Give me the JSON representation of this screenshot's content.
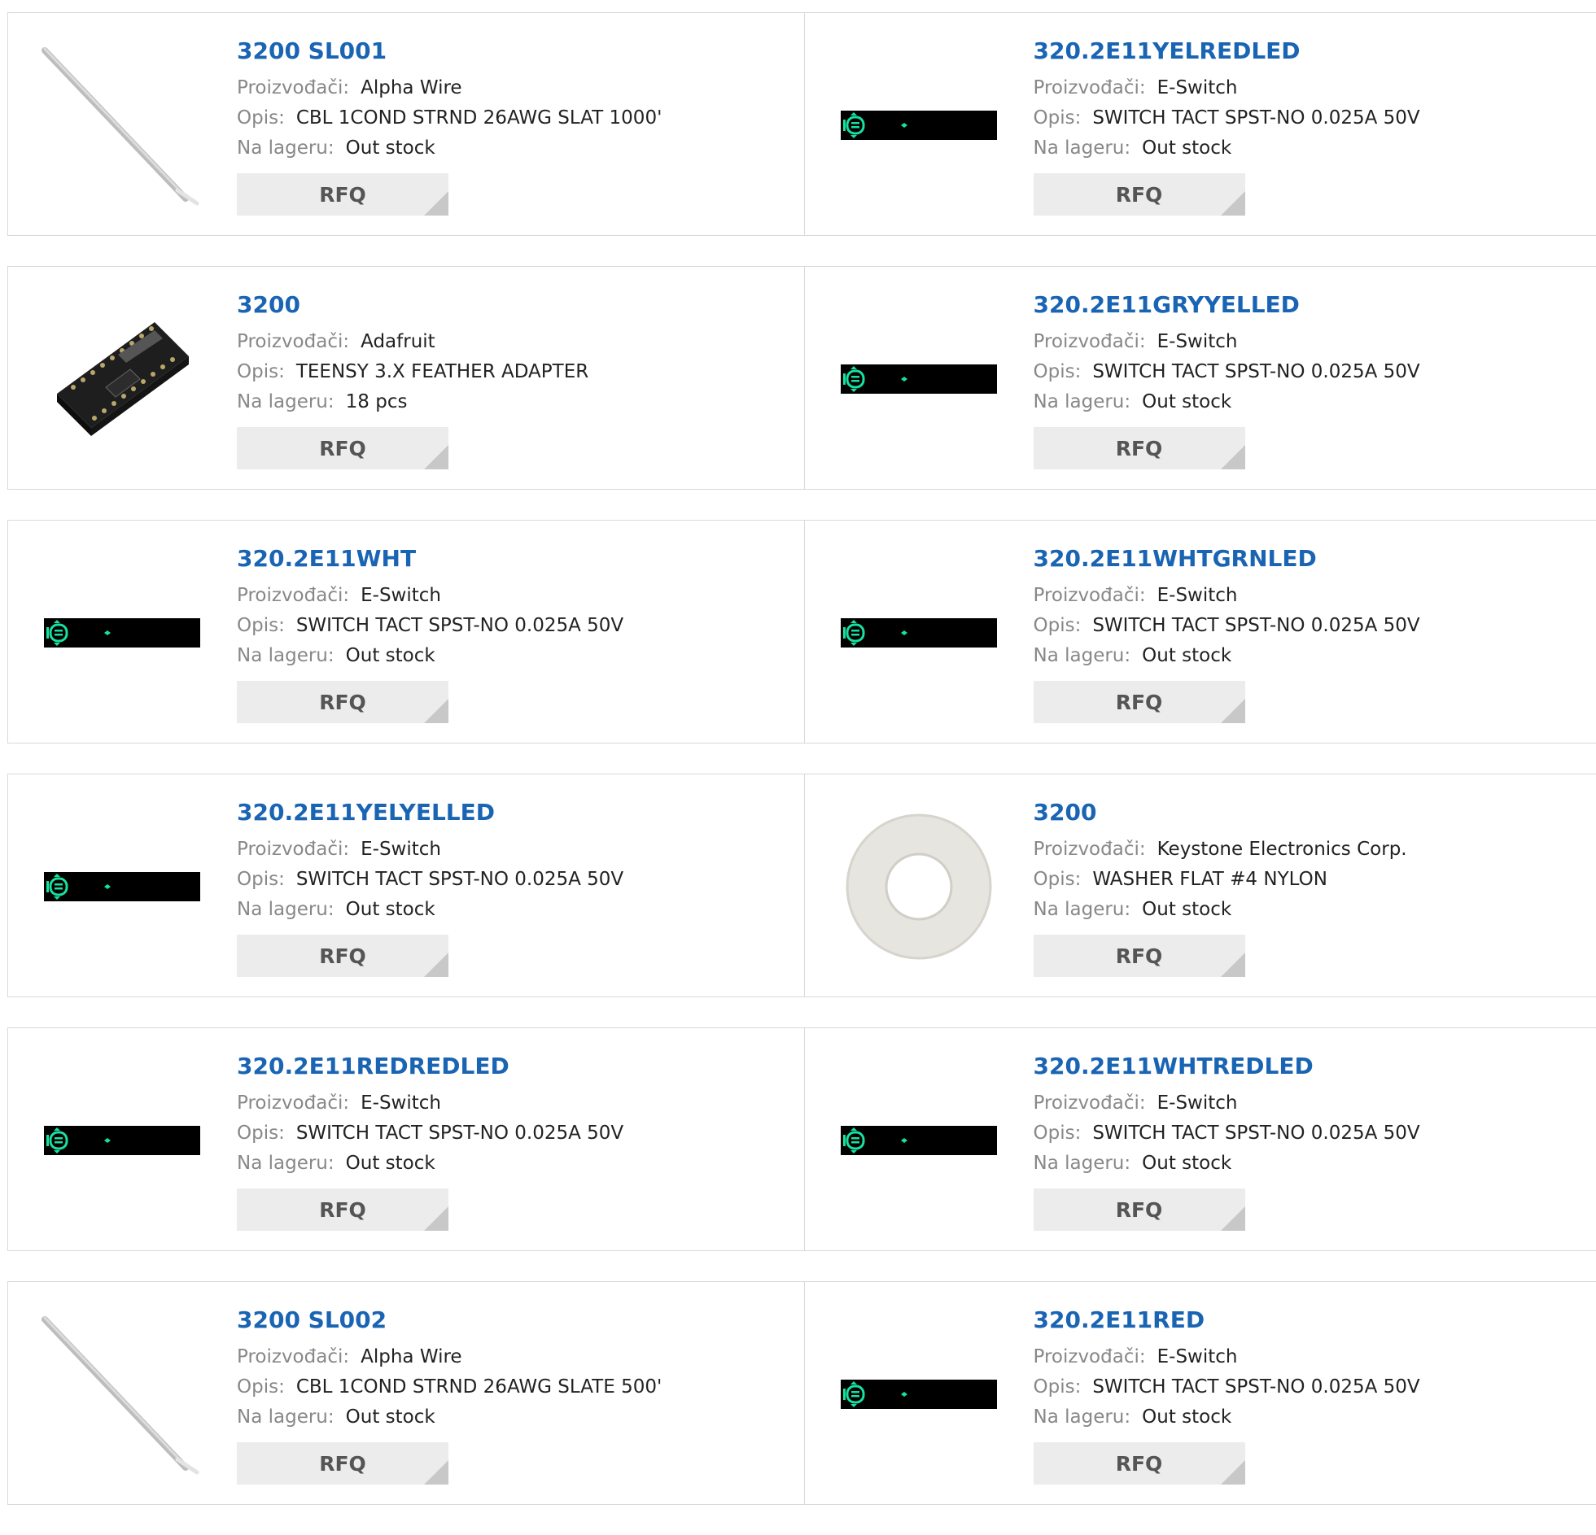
{
  "labels": {
    "manufacturer": "Proizvođači:",
    "description": "Opis:",
    "stock": "Na lageru:",
    "rfq": "RFQ"
  },
  "colors": {
    "part_link": "#1a64b4",
    "chip_body": "#000000",
    "chip_led": "#17e0a0"
  },
  "rows": [
    [
      {
        "part": "3200 SL001",
        "manufacturer": "Alpha Wire",
        "description": "CBL 1COND STRND 26AWG SLAT 1000'",
        "stock": "Out stock",
        "image": "wire-icon"
      },
      {
        "part": "320.2E11YELREDLED",
        "manufacturer": "E-Switch",
        "description": "SWITCH TACT SPST-NO 0.025A 50V",
        "stock": "Out stock",
        "image": "switch-icon"
      }
    ],
    [
      {
        "part": "3200",
        "manufacturer": "Adafruit",
        "description": "TEENSY 3.X FEATHER ADAPTER",
        "stock": "18 pcs",
        "image": "board-icon"
      },
      {
        "part": "320.2E11GRYYELLED",
        "manufacturer": "E-Switch",
        "description": "SWITCH TACT SPST-NO 0.025A 50V",
        "stock": "Out stock",
        "image": "switch-icon"
      }
    ],
    [
      {
        "part": "320.2E11WHT",
        "manufacturer": "E-Switch",
        "description": "SWITCH TACT SPST-NO 0.025A 50V",
        "stock": "Out stock",
        "image": "switch-icon"
      },
      {
        "part": "320.2E11WHTGRNLED",
        "manufacturer": "E-Switch",
        "description": "SWITCH TACT SPST-NO 0.025A 50V",
        "stock": "Out stock",
        "image": "switch-icon"
      }
    ],
    [
      {
        "part": "320.2E11YELYELLED",
        "manufacturer": "E-Switch",
        "description": "SWITCH TACT SPST-NO 0.025A 50V",
        "stock": "Out stock",
        "image": "switch-icon"
      },
      {
        "part": "3200",
        "manufacturer": "Keystone Electronics Corp.",
        "description": "WASHER FLAT #4 NYLON",
        "stock": "Out stock",
        "image": "washer-icon"
      }
    ],
    [
      {
        "part": "320.2E11REDREDLED",
        "manufacturer": "E-Switch",
        "description": "SWITCH TACT SPST-NO 0.025A 50V",
        "stock": "Out stock",
        "image": "switch-icon"
      },
      {
        "part": "320.2E11WHTREDLED",
        "manufacturer": "E-Switch",
        "description": "SWITCH TACT SPST-NO 0.025A 50V",
        "stock": "Out stock",
        "image": "switch-icon"
      }
    ],
    [
      {
        "part": "3200 SL002",
        "manufacturer": "Alpha Wire",
        "description": "CBL 1COND STRND 26AWG SLATE 500'",
        "stock": "Out stock",
        "image": "wire-icon"
      },
      {
        "part": "320.2E11RED",
        "manufacturer": "E-Switch",
        "description": "SWITCH TACT SPST-NO 0.025A 50V",
        "stock": "Out stock",
        "image": "switch-icon"
      }
    ]
  ]
}
